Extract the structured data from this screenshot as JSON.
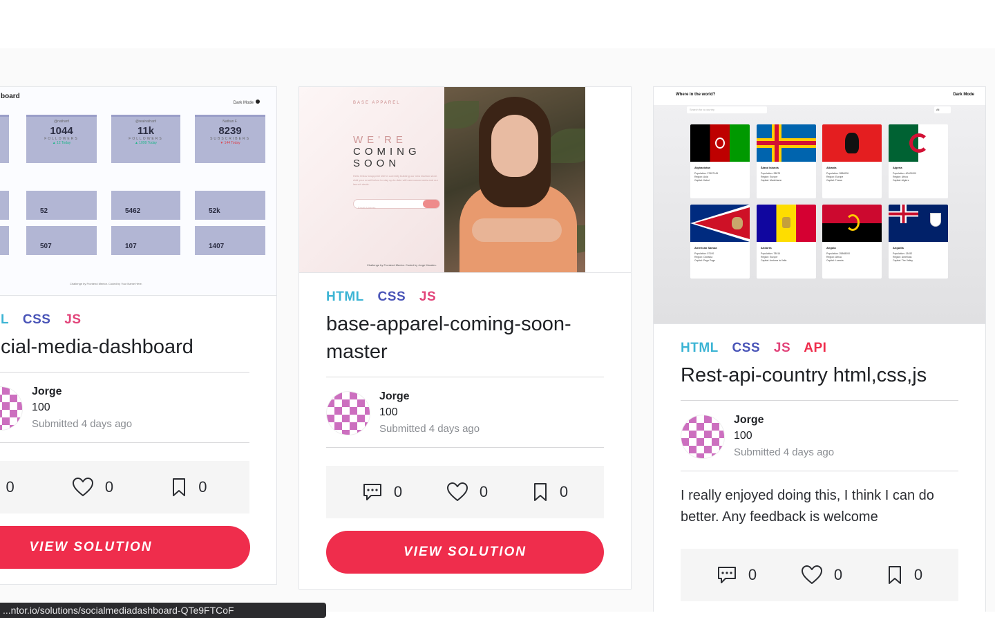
{
  "cards": [
    {
      "tags": [
        "L",
        "CSS",
        "JS"
      ],
      "title": "cial-media-dashboard",
      "author": {
        "name": "Jorge",
        "score": "100",
        "submitted": "Submitted 4 days ago"
      },
      "stats": {
        "comments": "0",
        "likes": "0",
        "bookmarks": "0"
      },
      "button": "VIEW SOLUTION",
      "preview": {
        "title": "board",
        "mode_label": "Dark Mode",
        "followers": [
          {
            "handle": "@nathanf",
            "count": "1044",
            "unit": "FOLLOWERS",
            "change": "▲ 12 Today",
            "change_color": "#1eb589"
          },
          {
            "handle": "@realnathanf",
            "count": "11k",
            "unit": "FOLLOWERS",
            "change": "▲ 1099 Today",
            "change_color": "#1eb589"
          },
          {
            "handle": "Nathan F.",
            "count": "8239",
            "unit": "SUBSCRIBERS",
            "change": "▼ 144 Today",
            "change_color": "#dc414c"
          }
        ],
        "overview": [
          {
            "label": "Likes",
            "value": "52",
            "change": "▼ 2%",
            "change_color": "#dc414c"
          },
          {
            "label": "Likes",
            "value": "5462",
            "change": "▲ 2257%",
            "change_color": "#1eb589"
          },
          {
            "label": "Profile Views",
            "value": "52k",
            "change": "▲ 1375%",
            "change_color": "#1eb589"
          },
          {
            "label": "Likes",
            "value": "507",
            "change": "▲ 553%",
            "change_color": "#1eb589"
          },
          {
            "label": "Likes",
            "value": "107",
            "change": "▼ 19%",
            "change_color": "#dc414c"
          },
          {
            "label": "Total Views",
            "value": "1407",
            "change": "▼ 12%",
            "change_color": "#dc414c"
          }
        ],
        "footer": "Challenge by Frontend Mentor. Coded by Your Name Here."
      }
    },
    {
      "tags": [
        "HTML",
        "CSS",
        "JS"
      ],
      "title": "base-apparel-coming-soon-master",
      "author": {
        "name": "Jorge",
        "score": "100",
        "submitted": "Submitted 4 days ago"
      },
      "stats": {
        "comments": "0",
        "likes": "0",
        "bookmarks": "0"
      },
      "button": "VIEW SOLUTION",
      "preview": {
        "logo": "BASE APPAREL",
        "heading_pink": "WE'RE",
        "heading_dark_1": "COMING",
        "heading_dark_2": "SOON",
        "paragraph": "Hello fellow shoppers! We're currently building our new fashion store. Add your email below to stay up-to-date with announcements and our launch deals.",
        "input_placeholder": "Email Address",
        "footer": "Challenge by Frontend Mentor. Coded by Jorge Morales."
      }
    },
    {
      "tags": [
        "HTML",
        "CSS",
        "JS",
        "API"
      ],
      "title": "Rest-api-country html,css,js",
      "author": {
        "name": "Jorge",
        "score": "100",
        "submitted": "Submitted 4 days ago"
      },
      "description": "I really enjoyed doing this, I think I can do better. Any feedback is welcome",
      "stats": {
        "comments": "0",
        "likes": "0",
        "bookmarks": "0"
      },
      "preview": {
        "title": "Where in the world?",
        "mode_label": "Dark Mode",
        "search_placeholder": "Search for a country",
        "filter_label": "All",
        "countries": [
          {
            "name": "Afghanistan",
            "population": "Population: 27657145",
            "region": "Region: Asia",
            "capital": "Capital: Kabul"
          },
          {
            "name": "Åland Islands",
            "population": "Population: 28875",
            "region": "Region: Europe",
            "capital": "Capital: Mariehamn"
          },
          {
            "name": "Albania",
            "population": "Population: 2886026",
            "region": "Region: Europe",
            "capital": "Capital: Tirana"
          },
          {
            "name": "Algeria",
            "population": "Population: 40400000",
            "region": "Region: Africa",
            "capital": "Capital: Algiers"
          },
          {
            "name": "American Samoa",
            "population": "Population: 57100",
            "region": "Region: Oceania",
            "capital": "Capital: Pago Pago"
          },
          {
            "name": "Andorra",
            "population": "Population: 78014",
            "region": "Region: Europe",
            "capital": "Capital: Andorra la Vella"
          },
          {
            "name": "Angola",
            "population": "Population: 25868000",
            "region": "Region: Africa",
            "capital": "Capital: Luanda"
          },
          {
            "name": "Anguilla",
            "population": "Population: 13452",
            "region": "Region: Americas",
            "capital": "Capital: The Valley"
          }
        ]
      }
    }
  ],
  "status_url": "...ntor.io/solutions/socialmediadashboard-QTe9FTCoF",
  "colors": {
    "accent": "#ef2d4c",
    "html_tag": "#3cb4d4",
    "css_tag": "#4a55b8",
    "js_tag": "#e2447a",
    "api_tag": "#ef2d4c",
    "avatar": "#cc6fbf"
  }
}
